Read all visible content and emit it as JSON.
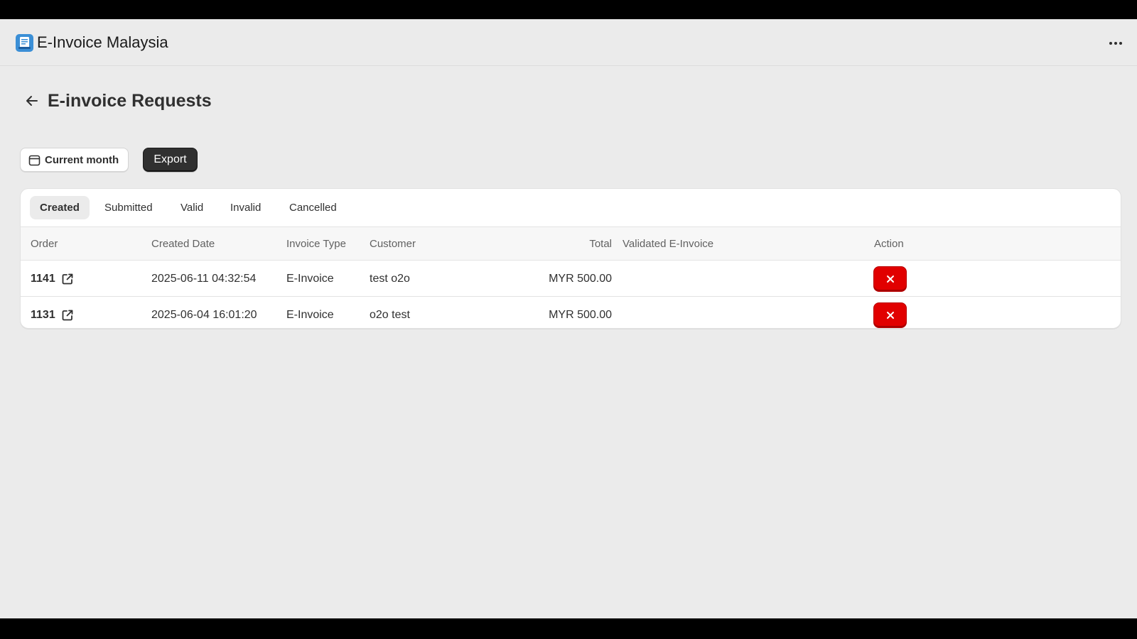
{
  "app": {
    "title": "E-Invoice Malaysia",
    "icon": "receipt-app-icon",
    "more_icon": "more-horizontal-icon"
  },
  "page": {
    "title": "E-invoice Requests",
    "back_icon": "arrow-left-icon"
  },
  "toolbar": {
    "date_filter_label": "Current month",
    "date_filter_icon": "calendar-icon",
    "export_label": "Export"
  },
  "tabs": [
    {
      "label": "Created",
      "active": true
    },
    {
      "label": "Submitted",
      "active": false
    },
    {
      "label": "Valid",
      "active": false
    },
    {
      "label": "Invalid",
      "active": false
    },
    {
      "label": "Cancelled",
      "active": false
    }
  ],
  "table": {
    "columns": [
      "Order",
      "Created Date",
      "Invoice Type",
      "Customer",
      "Total",
      "Validated E-Invoice",
      "Action"
    ],
    "rows": [
      {
        "order": "1141",
        "created_date": "2025-06-11 04:32:54",
        "invoice_type": "E-Invoice",
        "customer": "test o2o",
        "total": "MYR 500.00",
        "validated": ""
      },
      {
        "order": "1131",
        "created_date": "2025-06-04 16:01:20",
        "invoice_type": "E-Invoice",
        "customer": "o2o test",
        "total": "MYR 500.00",
        "validated": ""
      }
    ]
  },
  "colors": {
    "background": "#ebebeb",
    "primary_button": "#303030",
    "danger_button": "#e10000"
  }
}
